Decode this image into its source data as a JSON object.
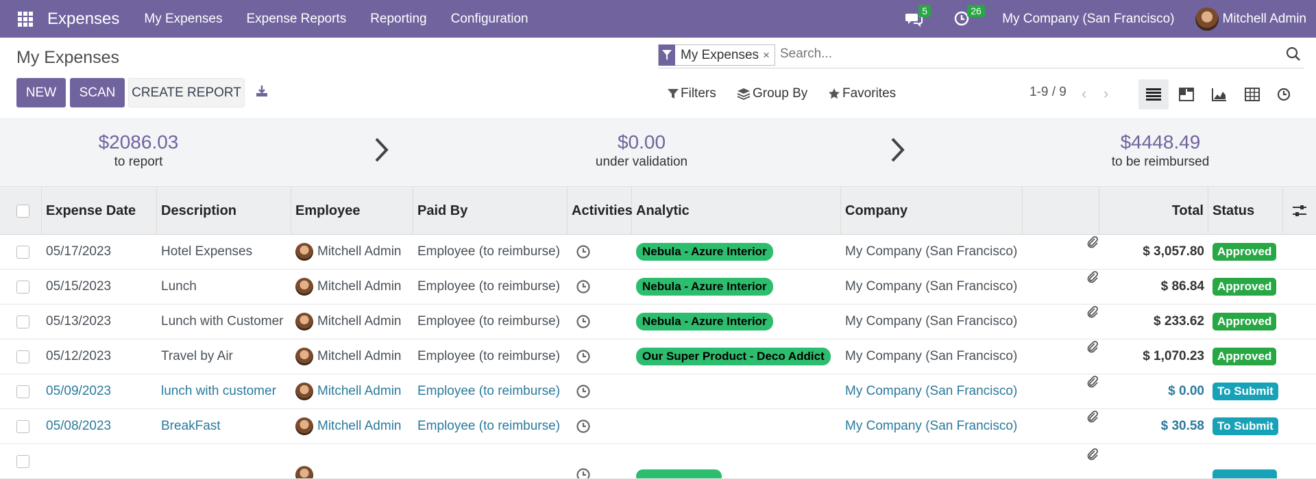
{
  "navbar": {
    "app_name": "Expenses",
    "menu": [
      "My Expenses",
      "Expense Reports",
      "Reporting",
      "Configuration"
    ],
    "messages_count": "5",
    "activities_count": "26",
    "company": "My Company (San Francisco)",
    "user": "Mitchell Admin"
  },
  "control": {
    "breadcrumb": "My Expenses",
    "new_label": "NEW",
    "scan_label": "SCAN",
    "create_report_label": "CREATE REPORT",
    "facet_label": "My Expenses",
    "facet_remove": "×",
    "search_placeholder": "Search...",
    "filters_label": "Filters",
    "groupby_label": "Group By",
    "favorites_label": "Favorites",
    "pager": "1-9 / 9",
    "pager_prev": "‹",
    "pager_next": "›"
  },
  "stats": [
    {
      "value": "$2086.03",
      "label": "to report"
    },
    {
      "value": "$0.00",
      "label": "under validation"
    },
    {
      "value": "$4448.49",
      "label": "to be reimbursed"
    }
  ],
  "table": {
    "headers": {
      "date": "Expense Date",
      "description": "Description",
      "employee": "Employee",
      "paid_by": "Paid By",
      "activities": "Activities",
      "analytic": "Analytic",
      "company": "Company",
      "total": "Total",
      "status": "Status"
    },
    "rows": [
      {
        "date": "05/17/2023",
        "description": "Hotel Expenses",
        "employee": "Mitchell Admin",
        "paid_by": "Employee (to reimburse)",
        "analytic": "Nebula - Azure Interior",
        "company": "My Company (San Francisco)",
        "total": "$ 3,057.80",
        "status": "Approved"
      },
      {
        "date": "05/15/2023",
        "description": "Lunch",
        "employee": "Mitchell Admin",
        "paid_by": "Employee (to reimburse)",
        "analytic": "Nebula - Azure Interior",
        "company": "My Company (San Francisco)",
        "total": "$ 86.84",
        "status": "Approved"
      },
      {
        "date": "05/13/2023",
        "description": "Lunch with Customer",
        "employee": "Mitchell Admin",
        "paid_by": "Employee (to reimburse)",
        "analytic": "Nebula - Azure Interior",
        "company": "My Company (San Francisco)",
        "total": "$ 233.62",
        "status": "Approved"
      },
      {
        "date": "05/12/2023",
        "description": "Travel by Air",
        "employee": "Mitchell Admin",
        "paid_by": "Employee (to reimburse)",
        "analytic": "Our Super Product - Deco Addict",
        "company": "My Company (San Francisco)",
        "total": "$ 1,070.23",
        "status": "Approved"
      },
      {
        "date": "05/09/2023",
        "description": "lunch with customer",
        "employee": "Mitchell Admin",
        "paid_by": "Employee (to reimburse)",
        "analytic": "",
        "company": "My Company (San Francisco)",
        "total": "$ 0.00",
        "status": "To Submit"
      },
      {
        "date": "05/08/2023",
        "description": "BreakFast",
        "employee": "Mitchell Admin",
        "paid_by": "Employee (to reimburse)",
        "analytic": "",
        "company": "My Company (San Francisco)",
        "total": "$ 30.58",
        "status": "To Submit"
      },
      {
        "date": "",
        "description": "",
        "employee": "",
        "paid_by": "",
        "analytic": "",
        "company": "",
        "total": "",
        "status": ""
      }
    ]
  },
  "colors": {
    "brand": "#71639e",
    "approved": "#28a745",
    "to_submit": "#17a2b8",
    "analytic_tag": "#2dbd6e"
  }
}
